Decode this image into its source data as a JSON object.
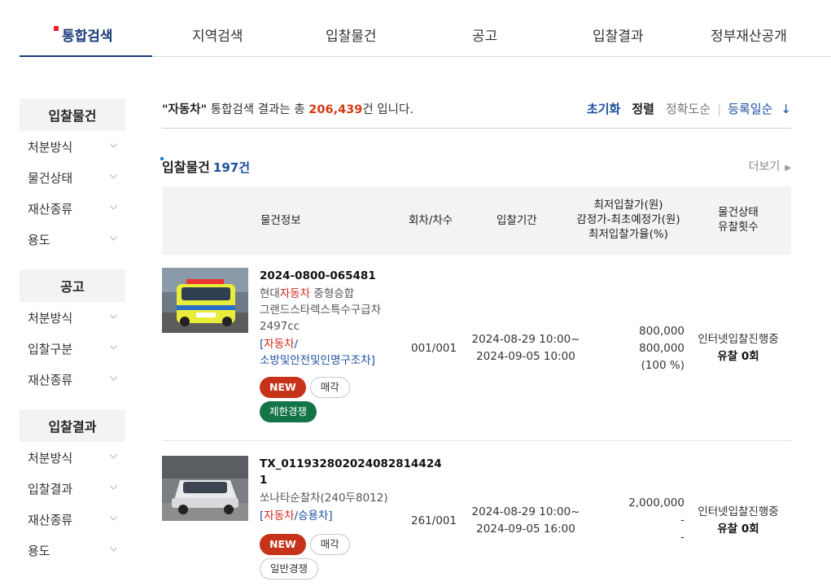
{
  "tabs": [
    {
      "label": "통합검색",
      "active": true
    },
    {
      "label": "지역검색"
    },
    {
      "label": "입찰물건"
    },
    {
      "label": "공고"
    },
    {
      "label": "입찰결과"
    },
    {
      "label": "정부재산공개"
    }
  ],
  "sidebar": {
    "groups": [
      {
        "title": "입찰물건",
        "items": [
          "처분방식",
          "물건상태",
          "재산종류",
          "용도"
        ]
      },
      {
        "title": "공고",
        "items": [
          "처분방식",
          "입찰구분",
          "재산종류"
        ]
      },
      {
        "title": "입찰결과",
        "items": [
          "처분방식",
          "입찰결과",
          "재산종류",
          "용도"
        ]
      }
    ]
  },
  "result": {
    "keyword": "\"자동차\"",
    "mid": " 통합검색 결과는 총 ",
    "count": "206,439",
    "suffix": "건 입니다."
  },
  "sort": {
    "reset": "초기화",
    "label": "정렬",
    "opt1": "정확도순",
    "sep": "|",
    "opt2": "등록일순",
    "arrow": "↓"
  },
  "section": {
    "title": "입찰물건",
    "count": "197건",
    "more": "더보기",
    "more_icon": "▶"
  },
  "table_header": {
    "info": "물건정보",
    "round": "회차/차수",
    "period": "입찰기간",
    "price1": "최저입찰가(원)",
    "price2": "감정가-최초예정가(원)",
    "price3": "최저입찰가율(%)",
    "status1": "물건상태",
    "status2": "유찰횟수"
  },
  "rows": [
    {
      "no": "2024-0800-065481",
      "title_pre": "현대",
      "title_hl": "자동차",
      "title_post": " 중형승합",
      "desc1": "그랜드스타렉스특수구급차",
      "desc2": "2497cc",
      "cat_open": "[",
      "cat_hl": "자동차",
      "cat_rest1": "/",
      "cat_rest2": "소방및안전및인명구조차]",
      "badge_new": "NEW",
      "badge_type": "매각",
      "badge_comp": "제한경쟁",
      "round": "001/001",
      "period_start": "2024-08-29 10:00~",
      "period_end": "2024-09-05 10:00",
      "price_min": "800,000",
      "price_appr": "800,000",
      "price_rate": "(100 %)",
      "status": "인터넷입찰진행중",
      "fail": "유찰 0회"
    },
    {
      "no": "TX_011932802024082814424​1",
      "title": "쏘나타순찰차(240두8012)",
      "cat_open": "[",
      "cat_hl": "자동차",
      "cat_rest": "/승용차]",
      "badge_new": "NEW",
      "badge_type": "매각",
      "badge_comp": "일반경쟁",
      "round": "261/001",
      "period_start": "2024-08-29 10:00~",
      "period_end": "2024-09-05 16:00",
      "price_min": "2,000,000",
      "price_appr": "-",
      "price_rate": "-",
      "status": "인터넷입찰진행중",
      "fail": "유찰 0회"
    }
  ],
  "colors": {
    "accent": "#1c3d7a",
    "link": "#1c4fa0",
    "count": "#d43a12",
    "new_badge": "#c7331a",
    "green_badge": "#137446"
  }
}
